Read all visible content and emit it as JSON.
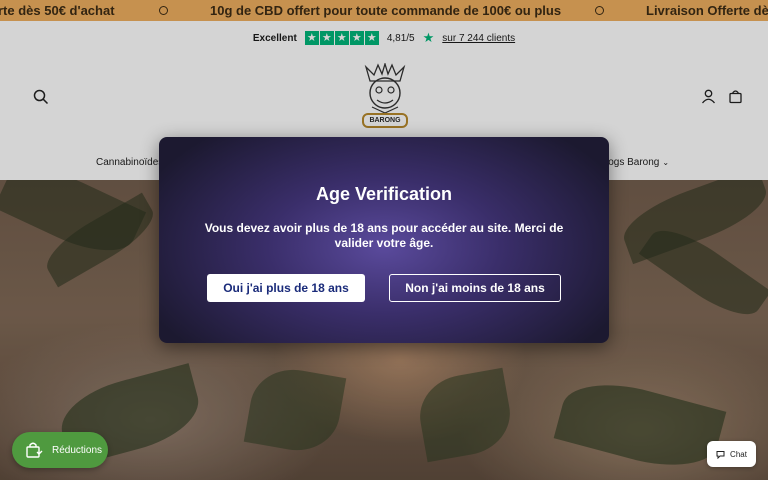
{
  "announcement": {
    "messages": [
      "rte dès 50€ d'achat",
      "10g de CBD offert pour toute commande de 100€ ou plus",
      "Livraison Offerte dès"
    ]
  },
  "trustpilot": {
    "rating_word": "Excellent",
    "stars": 5,
    "score": "4,81/5",
    "reviews_link": "sur 7 244 clients"
  },
  "header": {
    "logo_text": "BARONG",
    "nav_left": "Cannabinoïdes",
    "nav_right": "logs Barong"
  },
  "modal": {
    "title": "Age Verification",
    "body": "Vous devez avoir plus de 18 ans pour accéder au site. Merci de valider votre âge.",
    "yes_label": "Oui j'ai plus de 18 ans",
    "no_label": "Non j'ai moins de 18 ans"
  },
  "floating": {
    "reductions_label": "Réductions",
    "chat_label": "Chat"
  },
  "colors": {
    "announcement_bg": "#e2a55b",
    "trustpilot_green": "#00b67a",
    "reductions_green": "#4f9a3f",
    "modal_purple": "#3a2e6a"
  }
}
